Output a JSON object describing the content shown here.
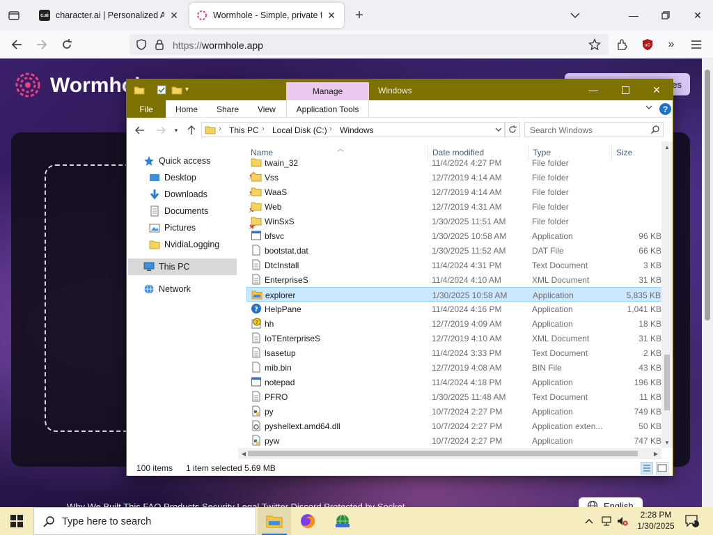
{
  "browser": {
    "tabs": [
      {
        "title": "character.ai | Personalized AI for every moment of your day",
        "favicon_text": "c.ai",
        "active": false
      },
      {
        "title": "Wormhole - Simple, private file sharing",
        "active": true
      }
    ],
    "url_scheme": "https://",
    "url_host": "wormhole.app"
  },
  "page": {
    "brand": "Wormhole",
    "top_button_tail": "es",
    "footer_links": "Why We Built This    FAQ    Products    Security    Legal    Twitter    Discord    Protected by Socket",
    "language_button": "English"
  },
  "explorer": {
    "title": "Windows",
    "manage_label": "Manage",
    "ribbon_tabs": [
      "File",
      "Home",
      "Share",
      "View",
      "Application Tools"
    ],
    "breadcrumb": [
      "This PC",
      "Local Disk (C:)",
      "Windows"
    ],
    "search_placeholder": "Search Windows",
    "nav": {
      "quick_access": "Quick access",
      "items": [
        "Desktop",
        "Downloads",
        "Documents",
        "Pictures",
        "NvidiaLogging"
      ],
      "this_pc": "This PC",
      "network": "Network"
    },
    "columns": {
      "name": "Name",
      "date": "Date modified",
      "type": "Type",
      "size": "Size"
    },
    "files": [
      {
        "name": "twain_32",
        "date": "11/4/2024 4:27 PM",
        "type": "File folder",
        "size": "",
        "icon": "folder"
      },
      {
        "name": "Vss",
        "date": "12/7/2019 4:14 AM",
        "type": "File folder",
        "size": "",
        "icon": "folder"
      },
      {
        "name": "WaaS",
        "date": "12/7/2019 4:14 AM",
        "type": "File folder",
        "size": "",
        "icon": "folder"
      },
      {
        "name": "Web",
        "date": "12/7/2019 4:31 AM",
        "type": "File folder",
        "size": "",
        "icon": "folder"
      },
      {
        "name": "WinSxS",
        "date": "1/30/2025 11:51 AM",
        "type": "File folder",
        "size": "",
        "icon": "folder"
      },
      {
        "name": "bfsvc",
        "date": "1/30/2025 10:58 AM",
        "type": "Application",
        "size": "96 KB",
        "icon": "app"
      },
      {
        "name": "bootstat.dat",
        "date": "1/30/2025 11:52 AM",
        "type": "DAT File",
        "size": "66 KB",
        "icon": "file"
      },
      {
        "name": "DtcInstall",
        "date": "11/4/2024 4:31 PM",
        "type": "Text Document",
        "size": "3 KB",
        "icon": "text"
      },
      {
        "name": "EnterpriseS",
        "date": "11/4/2024 4:10 AM",
        "type": "XML Document",
        "size": "31 KB",
        "icon": "text"
      },
      {
        "name": "explorer",
        "date": "1/30/2025 10:58 AM",
        "type": "Application",
        "size": "5,835 KB",
        "icon": "explorer",
        "selected": true
      },
      {
        "name": "HelpPane",
        "date": "11/4/2024 4:16 PM",
        "type": "Application",
        "size": "1,041 KB",
        "icon": "help"
      },
      {
        "name": "hh",
        "date": "12/7/2019 4:09 AM",
        "type": "Application",
        "size": "18 KB",
        "icon": "hh"
      },
      {
        "name": "IoTEnterpriseS",
        "date": "12/7/2019 4:10 AM",
        "type": "XML Document",
        "size": "31 KB",
        "icon": "text"
      },
      {
        "name": "lsasetup",
        "date": "11/4/2024 3:33 PM",
        "type": "Text Document",
        "size": "2 KB",
        "icon": "text"
      },
      {
        "name": "mib.bin",
        "date": "12/7/2019 4:08 AM",
        "type": "BIN File",
        "size": "43 KB",
        "icon": "file"
      },
      {
        "name": "notepad",
        "date": "11/4/2024 4:18 PM",
        "type": "Application",
        "size": "196 KB",
        "icon": "app"
      },
      {
        "name": "PFRO",
        "date": "1/30/2025 11:48 AM",
        "type": "Text Document",
        "size": "11 KB",
        "icon": "text"
      },
      {
        "name": "py",
        "date": "10/7/2024 2:27 PM",
        "type": "Application",
        "size": "749 KB",
        "icon": "py"
      },
      {
        "name": "pyshellext.amd64.dll",
        "date": "10/7/2024 2:27 PM",
        "type": "Application exten...",
        "size": "50 KB",
        "icon": "dll"
      },
      {
        "name": "pyw",
        "date": "10/7/2024 2:27 PM",
        "type": "Application",
        "size": "747 KB",
        "icon": "py"
      }
    ],
    "status": {
      "items": "100 items",
      "selected": "1 item selected  5.69 MB"
    }
  },
  "taskbar": {
    "search_placeholder": "Type here to search",
    "time": "2:28 PM",
    "date": "1/30/2025",
    "notification_count": "4"
  },
  "colors": {
    "explorer_accent": "#7d7100",
    "manage_tab": "#ecc9ee",
    "selection": "#cce8ff",
    "taskbar": "#f5ecc0"
  }
}
